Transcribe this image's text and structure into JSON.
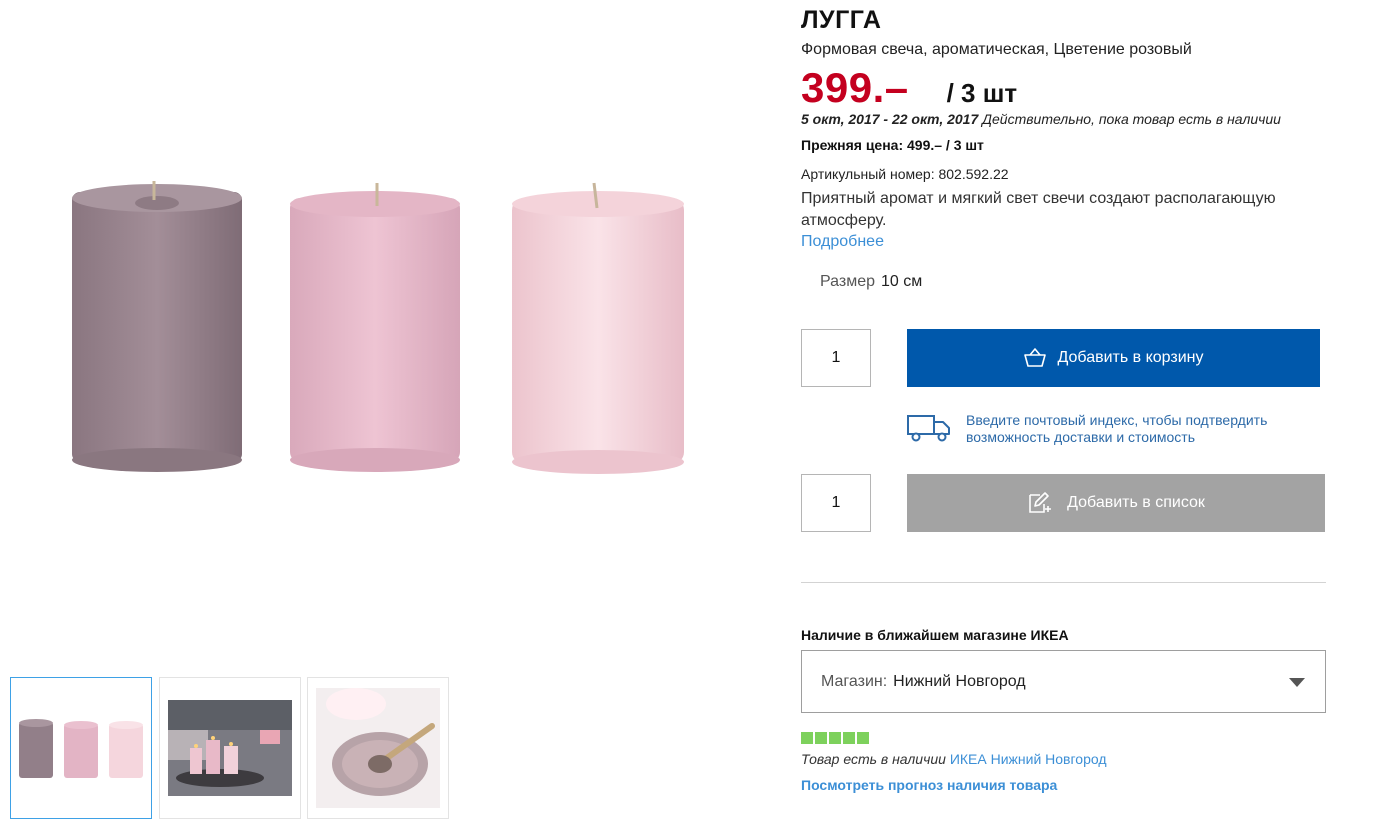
{
  "product": {
    "name": "ЛУГГА",
    "subtitle": "Формовая свеча, ароматическая, Цветение розовый",
    "price": "399.–",
    "price_unit": "/ 3 шт",
    "validity_dates": "5 окт, 2017 - 22 окт, 2017",
    "validity_note": "Действительно, пока товар есть в наличии",
    "old_price": "Прежняя цена: 499.– / 3 шт",
    "article": "Артикульный номер: 802.592.22",
    "description": "Приятный аромат и мягкий свет свечи создают располагающую атмосферу.",
    "more_link": "Подробнее"
  },
  "size": {
    "label": "Размер",
    "value": "10 см"
  },
  "cart": {
    "quantity": "1",
    "button": "Добавить в корзину",
    "icon": "basket-icon"
  },
  "delivery": {
    "text": "Введите почтовый индекс, чтобы подтвердить возможность доставки и стоимость",
    "icon": "truck-icon"
  },
  "list": {
    "quantity": "1",
    "button": "Добавить в список",
    "icon": "pencil-list-icon"
  },
  "availability": {
    "title": "Наличие в ближайшем магазине ИКЕА",
    "store_label": "Магазин:",
    "store_value": "Нижний Новгород",
    "stock_level": 5,
    "stock_text": "Товар есть в наличии",
    "stock_store": "ИКЕА Нижний Новгород",
    "forecast_link": "Посмотреть прогноз наличия товара"
  },
  "colors": {
    "price": "#c4001f",
    "primary_button": "#0058ab",
    "secondary_button": "#a3a3a3",
    "link": "#3c8fd6",
    "stock": "#7dd15c"
  }
}
